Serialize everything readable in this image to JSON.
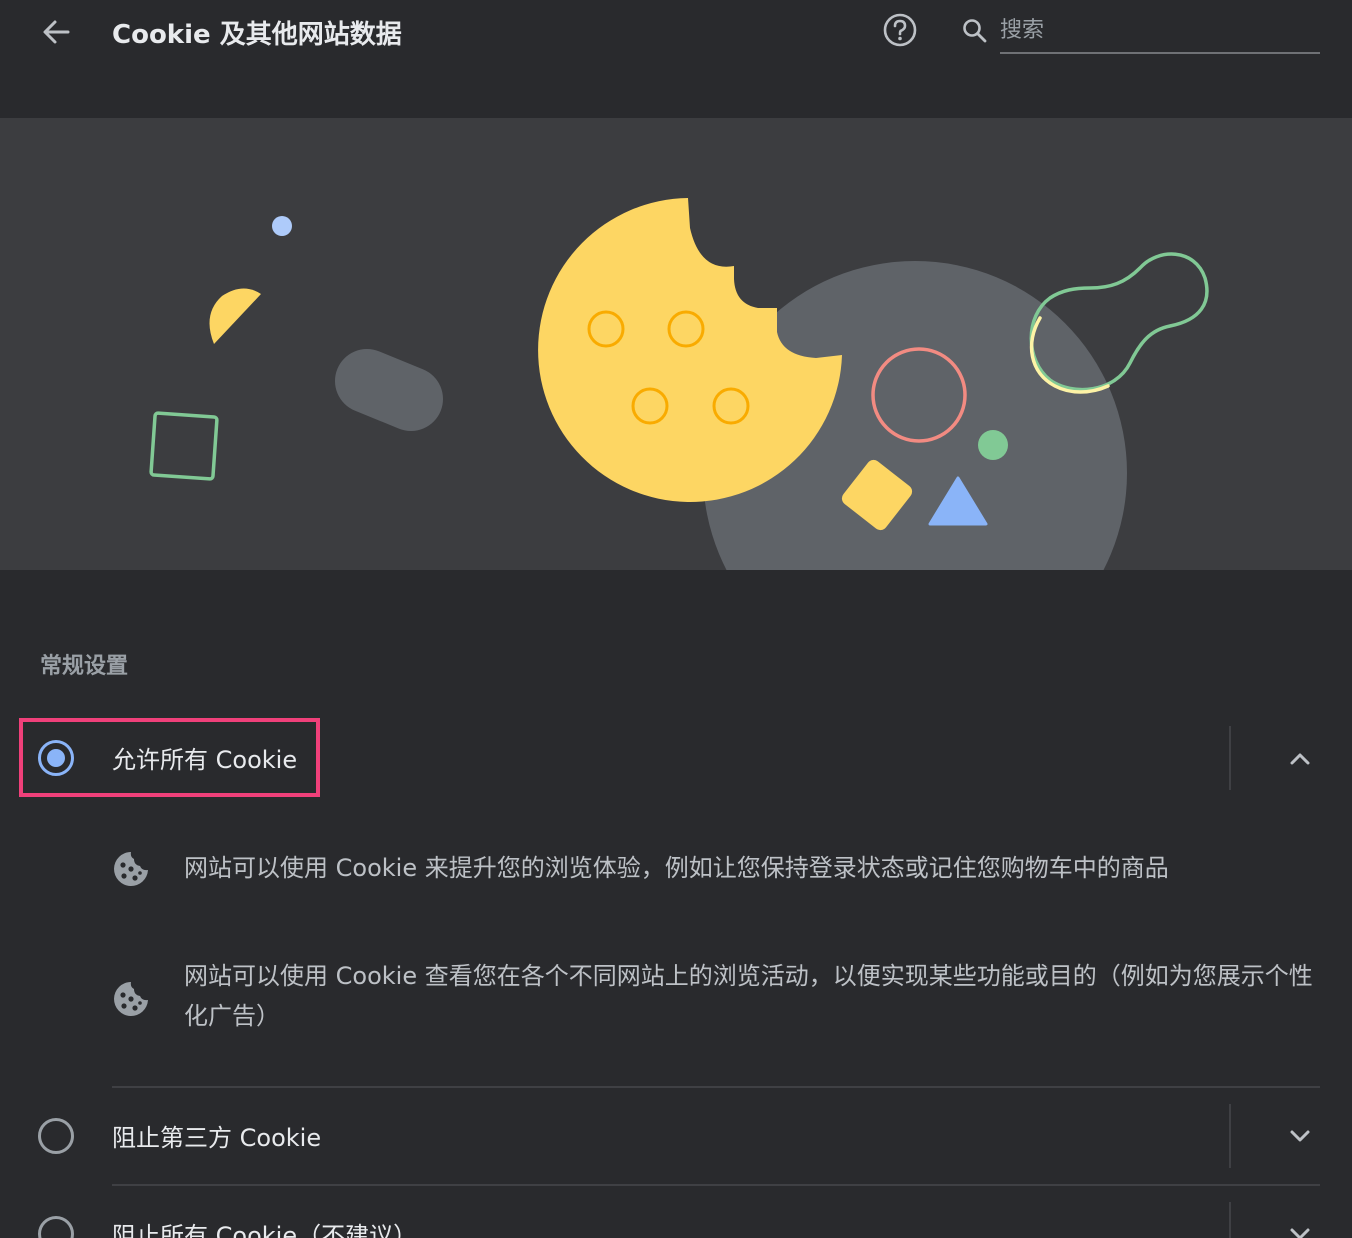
{
  "header": {
    "title": "Cookie 及其他网站数据",
    "search_placeholder": "搜索"
  },
  "section": {
    "title": "常规设置"
  },
  "options": [
    {
      "label": "允许所有 Cookie",
      "checked": true,
      "expanded": true,
      "descriptions": [
        "网站可以使用 Cookie 来提升您的浏览体验，例如让您保持登录状态或记住您购物车中的商品",
        "网站可以使用 Cookie 查看您在各个不同网站上的浏览活动，以便实现某些功能或目的（例如为您展示个性化广告）"
      ]
    },
    {
      "label": "阻止第三方 Cookie",
      "checked": false,
      "expanded": false
    },
    {
      "label": "阻止所有 Cookie（不建议）",
      "checked": false,
      "expanded": false
    }
  ],
  "icons": {
    "back": "arrow-back-icon",
    "help": "help-icon",
    "search": "search-icon",
    "cookie": "cookie-icon",
    "chevron_up": "chevron-up-icon",
    "chevron_down": "chevron-down-icon"
  },
  "colors": {
    "background": "#292a2d",
    "banner": "#3c3d40",
    "accent": "#8ab4f8",
    "highlight": "#f0407a",
    "cookie_yellow": "#fdd663"
  }
}
